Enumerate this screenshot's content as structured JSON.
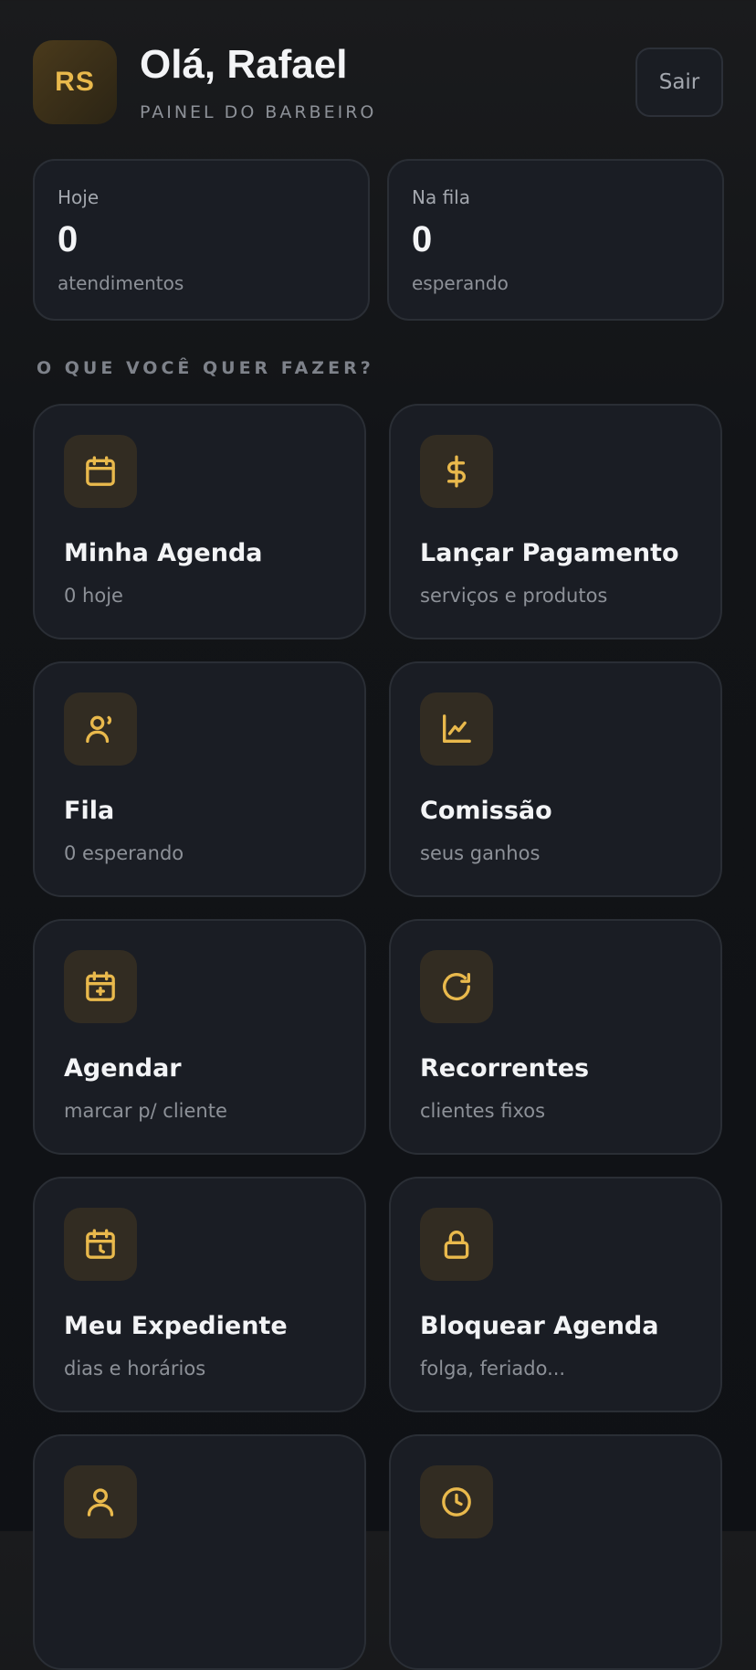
{
  "header": {
    "avatar_initials": "RS",
    "greeting": "Olá, Rafael",
    "subtitle": "PAINEL DO BARBEIRO",
    "logout_label": "Sair"
  },
  "stats": [
    {
      "label": "Hoje",
      "value": "0",
      "unit": "atendimentos"
    },
    {
      "label": "Na fila",
      "value": "0",
      "unit": "esperando"
    }
  ],
  "section_title": "O QUE VOCÊ QUER FAZER?",
  "actions": [
    {
      "icon": "calendar-icon",
      "title": "Minha Agenda",
      "desc": "0 hoje"
    },
    {
      "icon": "dollar-icon",
      "title": "Lançar Pagamento",
      "desc": "serviços e produtos"
    },
    {
      "icon": "user-queue-icon",
      "title": "Fila",
      "desc": "0 esperando"
    },
    {
      "icon": "chart-line-icon",
      "title": "Comissão",
      "desc": "seus ganhos"
    },
    {
      "icon": "calendar-plus-icon",
      "title": "Agendar",
      "desc": "marcar p/ cliente"
    },
    {
      "icon": "refresh-icon",
      "title": "Recorrentes",
      "desc": "clientes fixos"
    },
    {
      "icon": "calendar-clock-icon",
      "title": "Meu Expediente",
      "desc": "dias e horários"
    },
    {
      "icon": "lock-icon",
      "title": "Bloquear Agenda",
      "desc": "folga, feriado..."
    },
    {
      "icon": "user-icon",
      "title": "",
      "desc": ""
    },
    {
      "icon": "clock-icon",
      "title": "",
      "desc": ""
    }
  ],
  "colors": {
    "accent": "#e9b94c",
    "card_bg": "#1a1d24",
    "icon_bg": "#322c22",
    "page_bg": "#121417"
  }
}
